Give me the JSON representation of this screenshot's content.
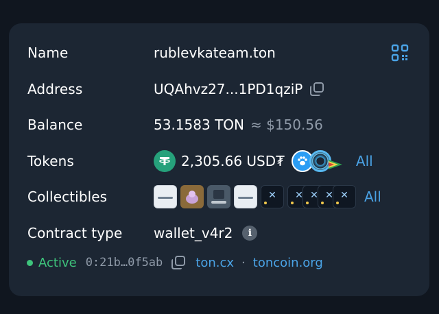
{
  "rows": {
    "name": {
      "label": "Name",
      "value": "rublevkateam.ton"
    },
    "address": {
      "label": "Address",
      "value": "UQAhvz27...1PD1qziP"
    },
    "balance": {
      "label": "Balance",
      "value": "53.1583 TON",
      "fiat": "≈ $150.56"
    },
    "tokens": {
      "label": "Tokens",
      "amount": "2,305.66 USD₮",
      "all_label": "All"
    },
    "collectibles": {
      "label": "Collectibles",
      "all_label": "All"
    },
    "contract_type": {
      "label": "Contract type",
      "value": "wallet_v4r2"
    }
  },
  "footer": {
    "status": "Active",
    "code_hash": "0:21b…0f5ab",
    "link1": "ton.cx",
    "separator": "·",
    "link2": "toncoin.org"
  },
  "icons": {
    "qr": "qr-code-icon",
    "copy": "copy-icon",
    "info": "info-icon",
    "tether": "tether-icon",
    "paw": "paw-token-icon"
  },
  "colors": {
    "background": "#10161f",
    "card": "#1c2633",
    "accent": "#4aa3e6",
    "active": "#3ec47c",
    "muted": "#8f9aa8"
  }
}
